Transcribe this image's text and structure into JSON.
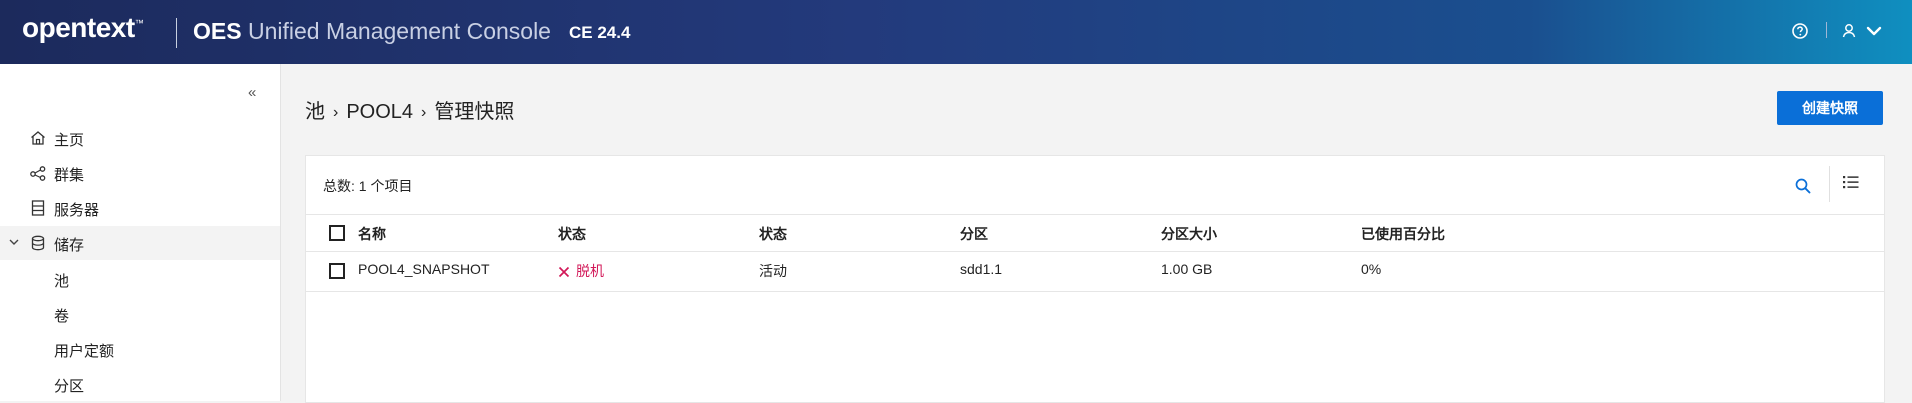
{
  "header": {
    "brand": "opentext",
    "brand_tm": "™",
    "product_bold": "OES",
    "product_rest": "Unified Management Console",
    "version": "CE 24.4",
    "icons": [
      "help-icon",
      "user-icon",
      "chevron-down-icon"
    ]
  },
  "sidebar": {
    "collapse_label": "«",
    "items": [
      {
        "label": "主页",
        "icon": "home-icon"
      },
      {
        "label": "群集",
        "icon": "cluster-icon"
      },
      {
        "label": "服务器",
        "icon": "server-icon"
      },
      {
        "label": "储存",
        "icon": "storage-icon",
        "expanded": true
      }
    ],
    "subitems": [
      {
        "label": "池"
      },
      {
        "label": "卷"
      },
      {
        "label": "用户定额"
      },
      {
        "label": "分区"
      }
    ]
  },
  "breadcrumb": {
    "items": [
      "池",
      "POOL4",
      "管理快照"
    ],
    "separator": "›"
  },
  "actions": {
    "create_snapshot": "创建快照"
  },
  "table": {
    "total": "总数: 1 个项目",
    "columns": [
      "名称",
      "状态",
      "状态",
      "分区",
      "分区大小",
      "已使用百分比"
    ],
    "rows": [
      {
        "name": "POOL4_SNAPSHOT",
        "status": "脱机",
        "state": "活动",
        "partition": "sdd1.1",
        "partition_size": "1.00 GB",
        "used_percent": "0%"
      }
    ]
  },
  "colors": {
    "accent": "#0a6fd8",
    "offline": "#d21858",
    "header_start": "#1c2a5c",
    "header_end": "#0f8fc0"
  }
}
